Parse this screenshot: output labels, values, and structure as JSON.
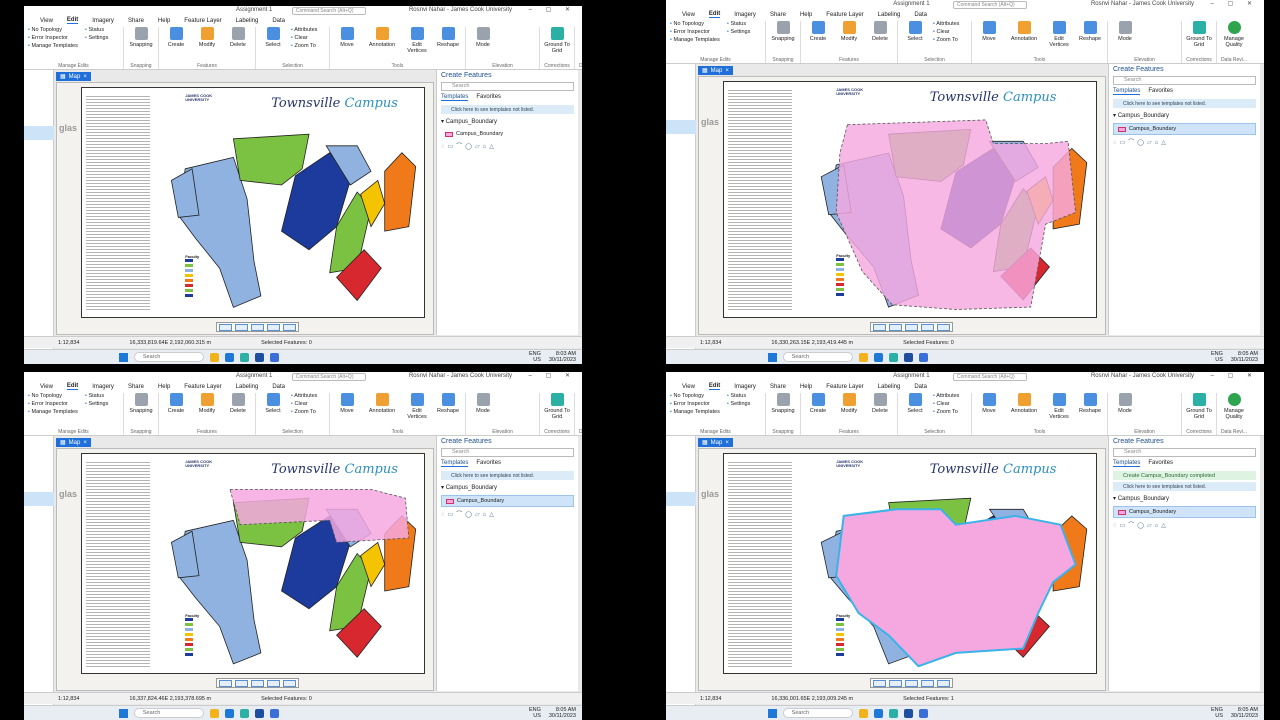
{
  "window": {
    "title": "Assignment 1",
    "search_placeholder": "Command Search (Alt+Q)",
    "user": "Rosnvi Nahar - James Cook University",
    "user_initials": "RN"
  },
  "menu": {
    "items": [
      "View",
      "Edit",
      "Imagery",
      "Share",
      "Help",
      "Feature Layer",
      "Labeling",
      "Data"
    ],
    "active": "Edit"
  },
  "ribbon": {
    "topology": "No Topology",
    "status": "Status",
    "error_inspector": "Error Inspector",
    "settings": "Settings",
    "manage_templates": "Manage Templates",
    "manage_edits": "Manage Edits",
    "snapping": "Snapping",
    "create": "Create",
    "modify": "Modify",
    "delete": "Delete",
    "features_group": "Features",
    "select": "Select",
    "attributes": "Attributes",
    "clear": "Clear",
    "zoom_to": "Zoom To",
    "selection_group": "Selection",
    "move": "Move",
    "annotation": "Annotation",
    "edit_vertices": "Edit Vertices",
    "reshape": "Reshape",
    "tools_group": "Tools",
    "mode": "Mode",
    "elevation_group": "Elevation",
    "ground_to_grid": "Ground To Grid",
    "corrections_group": "Corrections",
    "manage_quality": "Manage Quality",
    "data_review_group": "Data Revi..."
  },
  "map": {
    "tab": "Map",
    "title_word1": "Townsville",
    "title_word2": "Campus",
    "university": "JAMES COOK UNIVERSITY",
    "basemap_label": "glas",
    "legend_title": "Faculty"
  },
  "panes": [
    {
      "scale": "1:12,834",
      "coords": "16,333,819.64E 2,192,060.315 m",
      "selected": "Selected Features: 0",
      "time": "8:03 AM",
      "date": "30/11/2023"
    },
    {
      "scale": "1:12,834",
      "coords": "16,330,263.15E 2,193,419.445 m",
      "selected": "Selected Features: 0",
      "time": "8:05 AM",
      "date": "30/11/2023"
    },
    {
      "scale": "1:12,834",
      "coords": "16,337,824.46E 2,193,378.695 m",
      "selected": "Selected Features: 0",
      "time": "8:05 AM",
      "date": "30/11/2023"
    },
    {
      "scale": "1:12,834",
      "coords": "16,336,001.65E 2,193,009.245 m",
      "selected": "Selected Features: 1",
      "time": "8:05 AM",
      "date": "30/11/2023"
    }
  ],
  "create_features": {
    "title": "Create Features",
    "search_placeholder": "Search",
    "tab_templates": "Templates",
    "tab_favorites": "Favorites",
    "info": "Click here to see templates not listed.",
    "layer": "Campus_Boundary",
    "template": "Campus_Boundary",
    "completed": "Create Campus_Boundary completed"
  },
  "taskbar": {
    "search": "Search",
    "lang1": "ENG",
    "lang2": "US"
  },
  "colors": {
    "accent": "#1e6fd9",
    "boundary_fill": "#f5a8e0",
    "zone_green": "#7cc242",
    "zone_blue": "#1c3b9c",
    "zone_lightblue": "#8fb2e0",
    "zone_orange": "#f07a1a",
    "zone_red": "#d7282f",
    "zone_yellow": "#f5c400"
  }
}
